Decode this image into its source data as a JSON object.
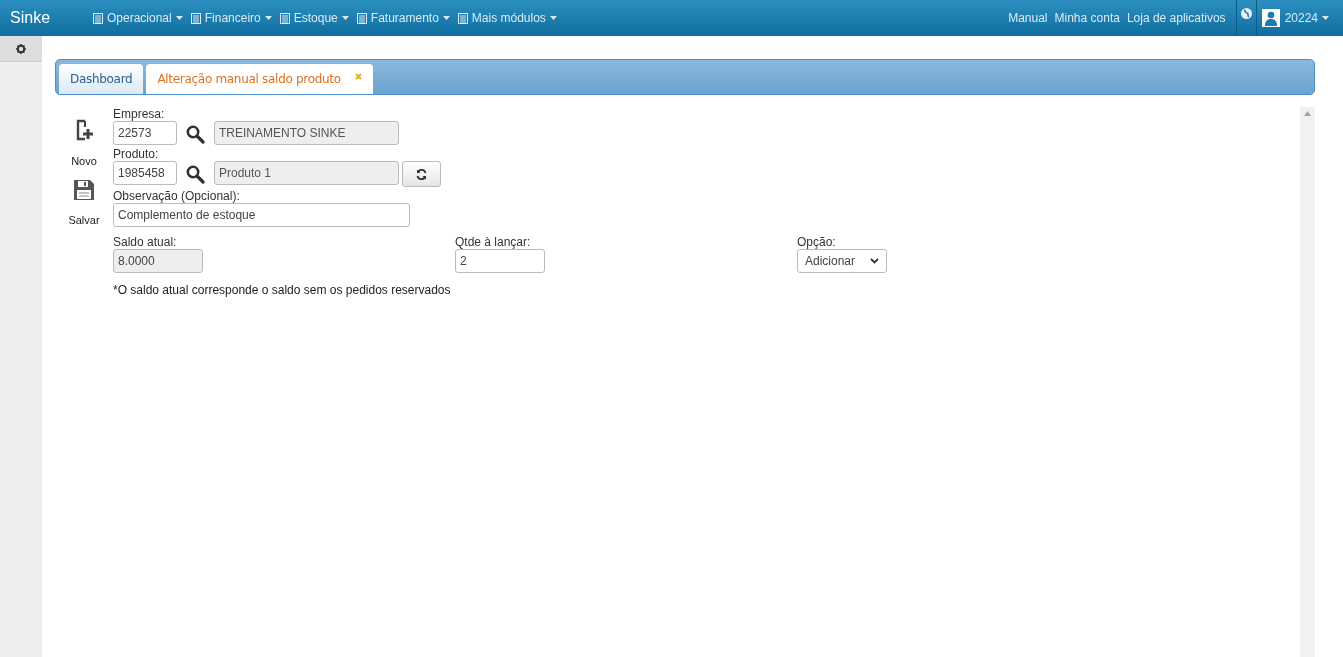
{
  "navbar": {
    "brand": "Sinke",
    "menus": [
      {
        "label": "Operacional"
      },
      {
        "label": "Financeiro"
      },
      {
        "label": "Estoque"
      },
      {
        "label": "Faturamento"
      },
      {
        "label": "Mais módulos"
      }
    ],
    "links": [
      "Manual",
      "Minha conta",
      "Loja de aplicativos"
    ],
    "user": "20224"
  },
  "tabs": [
    {
      "label": "Dashboard",
      "selected": false,
      "closable": false
    },
    {
      "label": "Alteração manual saldo produto",
      "selected": true,
      "closable": true
    }
  ],
  "toolbar": [
    {
      "kind": "new",
      "label": "Novo"
    },
    {
      "kind": "save",
      "label": "Salvar"
    }
  ],
  "form": {
    "empresa": {
      "label": "Empresa:",
      "code": "22573",
      "name": "TREINAMENTO SINKE"
    },
    "produto": {
      "label": "Produto:",
      "code": "1985458",
      "name": "Produto 1"
    },
    "observacao": {
      "label": "Observação (Opcional):",
      "value": "Complemento de estoque"
    },
    "saldo": {
      "label": "Saldo atual:",
      "value": "8.0000"
    },
    "qtde": {
      "label": "Qtde à lançar:",
      "value": "2"
    },
    "opcao": {
      "label": "Opção:",
      "value": "Adicionar"
    },
    "note": "*O saldo atual corresponde o saldo sem os pedidos reservados"
  }
}
